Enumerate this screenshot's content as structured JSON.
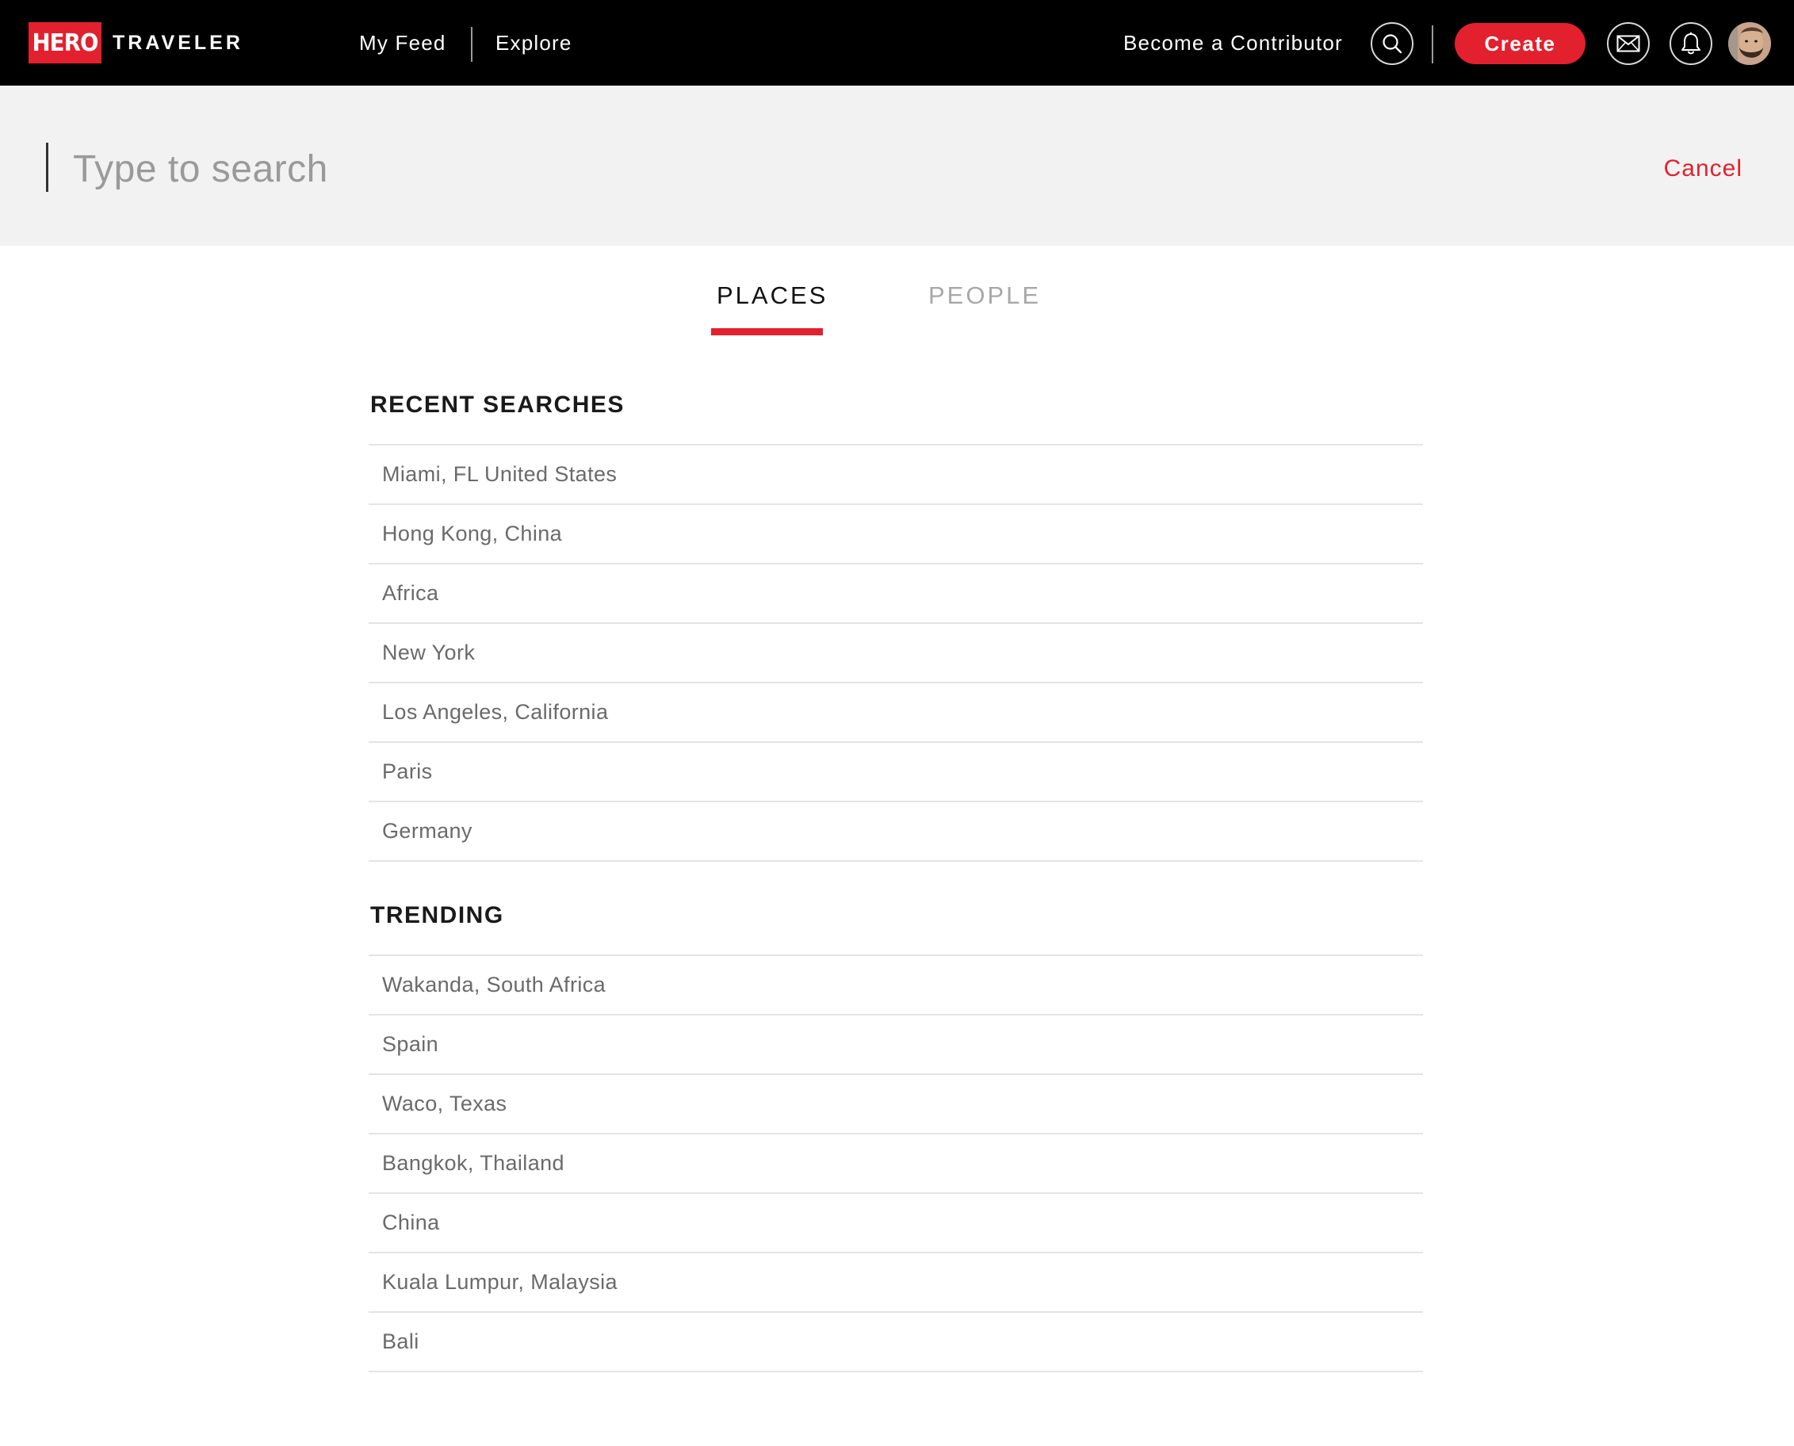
{
  "navbar": {
    "logo_hero": "HERO",
    "logo_traveler": "TRAVELER",
    "my_feed": "My Feed",
    "explore": "Explore",
    "become_contributor": "Become a Contributor",
    "create_label": "Create",
    "icons": [
      "search-icon",
      "mail-icon",
      "bell-icon"
    ]
  },
  "search": {
    "placeholder": "Type to search",
    "value": "",
    "cancel_label": "Cancel"
  },
  "tabs": [
    {
      "label": "PLACES",
      "active": true
    },
    {
      "label": "PEOPLE",
      "active": false
    }
  ],
  "recent": {
    "heading": "RECENT SEARCHES",
    "items": [
      "Miami, FL United States",
      "Hong Kong, China",
      "Africa",
      "New York",
      "Los Angeles, California",
      "Paris",
      "Germany"
    ]
  },
  "trending": {
    "heading": "TRENDING",
    "items": [
      "Wakanda, South Africa",
      "Spain",
      "Waco, Texas",
      "Bangkok, Thailand",
      "China",
      "Kuala Lumpur, Malaysia",
      "Bali"
    ]
  },
  "colors": {
    "brand_red": "#e3202d",
    "nav_background": "#000000",
    "search_background": "#f2f2f2",
    "inactive_tab": "#a8a8a8",
    "list_text": "#6a6a6a",
    "divider": "#e4e4e4"
  }
}
